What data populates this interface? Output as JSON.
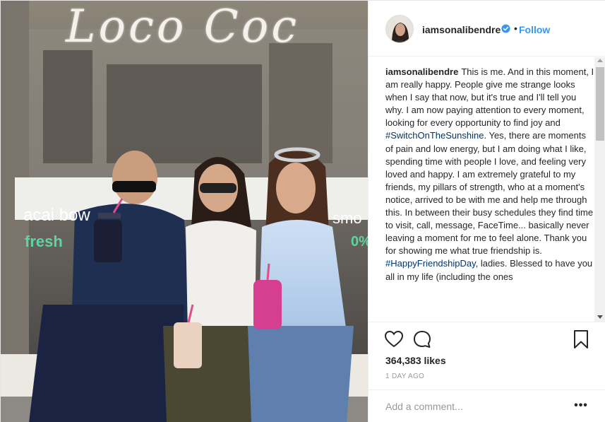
{
  "post": {
    "username": "iamsonalibendre",
    "verified": true,
    "separator": "•",
    "follow_label": "Follow",
    "photo": {
      "sign_text": "Loco Coc",
      "window_text_left": "acai bow",
      "window_text_left_2": "fresh",
      "window_text_right": "smo",
      "window_text_right_2": "0%"
    },
    "caption": {
      "user": "iamsonalibendre",
      "part1": "This is me. And in this moment, I am really happy. People give me strange looks when I say that now, but it's true and I'll tell you why. I am now paying attention to every moment, looking for every opportunity to find joy and ",
      "tag1": "#SwitchOnTheSunshine",
      "part2": ". Yes, there are moments of pain and low energy, but I am doing what I like, spending time with people I love, and feeling very loved and happy. I am extremely grateful to my friends, my pillars of strength, who at a moment's notice, arrived to be with me and help me through this. In between their busy schedules they find time to visit, call, message, FaceTime... basically never leaving a moment for me to feel alone. Thank you for showing me what true friendship is. ",
      "tag2": "#HappyFriendshipDay",
      "part3": ", ladies. Blessed to have you all in my life (including the ones"
    },
    "likes": "364,383 likes",
    "time": "1 DAY AGO",
    "comment_placeholder": "Add a comment...",
    "more_label": "•••",
    "colors": {
      "link": "#3897f0",
      "hashtag": "#003569",
      "verified": "#3897f0",
      "text": "#262626",
      "muted": "#999999"
    },
    "icons": [
      "heart-icon",
      "comment-icon",
      "bookmark-icon",
      "verified-badge-icon",
      "more-icon"
    ]
  }
}
